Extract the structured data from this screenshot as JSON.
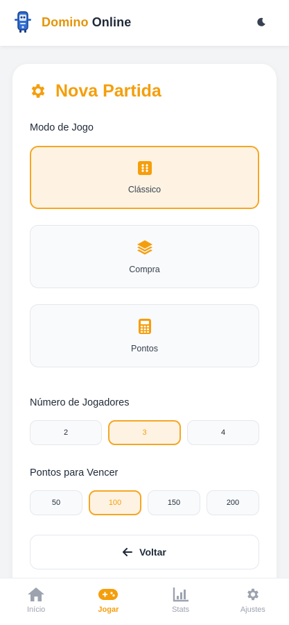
{
  "header": {
    "title_part1": "Domino",
    "title_part2": "Online",
    "logo_icon": "domino-mascot-icon",
    "theme_icon": "moon-icon"
  },
  "card": {
    "title": "Nova Partida",
    "title_icon": "gear-icon",
    "game_mode": {
      "label": "Modo de Jogo",
      "options": [
        {
          "label": "Clássico",
          "icon": "dice-icon",
          "selected": true
        },
        {
          "label": "Compra",
          "icon": "layers-icon",
          "selected": false
        },
        {
          "label": "Pontos",
          "icon": "calculator-icon",
          "selected": false
        }
      ]
    },
    "players": {
      "label": "Número de Jogadores",
      "options": [
        "2",
        "3",
        "4"
      ],
      "selected": "3"
    },
    "points_to_win": {
      "label": "Pontos para Vencer",
      "options": [
        "50",
        "100",
        "150",
        "200"
      ],
      "selected": "100"
    },
    "back_button": {
      "label": "Voltar",
      "icon": "arrow-left-icon"
    }
  },
  "bottom_nav": {
    "items": [
      {
        "label": "Início",
        "icon": "home-icon",
        "active": false
      },
      {
        "label": "Jogar",
        "icon": "gamepad-icon",
        "active": true
      },
      {
        "label": "Stats",
        "icon": "bar-chart-icon",
        "active": false
      },
      {
        "label": "Ajustes",
        "icon": "settings-icon",
        "active": false
      }
    ]
  },
  "colors": {
    "accent": "#f59e0b",
    "accent_light": "#fef3e2",
    "inactive": "#9ca3af",
    "background": "#f3f4f6"
  }
}
